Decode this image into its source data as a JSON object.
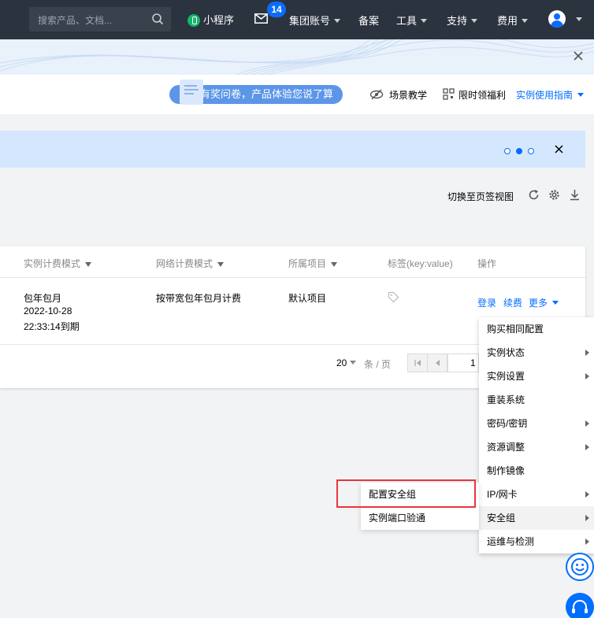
{
  "topnav": {
    "search_placeholder": "搜索产品、文档...",
    "mini_program": "小程序",
    "mail_badge": "14",
    "group_account": "集团账号",
    "beian": "备案",
    "tools": "工具",
    "support": "支持",
    "billing": "费用"
  },
  "header": {
    "survey": "有奖问卷，产品体验您说了算",
    "scene_teaching": "场景教学",
    "limited_welfare": "限时领福利",
    "usage_guide": "实例使用指南"
  },
  "toolbar": {
    "switch_view": "切换至页签视图"
  },
  "table": {
    "columns": [
      "实例计费模式",
      "网络计费模式",
      "所属项目",
      "标签(key:value)",
      "操作"
    ],
    "row": {
      "billing_mode": "包年包月",
      "date": "2022-10-28",
      "expire": "22:33:14到期",
      "network_mode": "按带宽包年包月计费",
      "project": "默认项目",
      "op_login": "登录",
      "op_renew": "续费",
      "op_more": "更多"
    },
    "pagination": {
      "page_size": "20",
      "unit": "条 / 页",
      "page": "1"
    }
  },
  "menu": {
    "items": [
      {
        "label": "购买相同配置",
        "submenu": false
      },
      {
        "label": "实例状态",
        "submenu": true
      },
      {
        "label": "实例设置",
        "submenu": true
      },
      {
        "label": "重装系统",
        "submenu": false
      },
      {
        "label": "密码/密钥",
        "submenu": true
      },
      {
        "label": "资源调整",
        "submenu": true
      },
      {
        "label": "制作镜像",
        "submenu": false
      },
      {
        "label": "IP/网卡",
        "submenu": true
      },
      {
        "label": "安全组",
        "submenu": true
      },
      {
        "label": "运维与检测",
        "submenu": true
      }
    ],
    "submenu": [
      "配置安全组",
      "实例端口验通"
    ]
  },
  "colors": {
    "nav_bg": "#2b333f",
    "accent": "#006eff",
    "highlight_border": "#e8343f"
  }
}
